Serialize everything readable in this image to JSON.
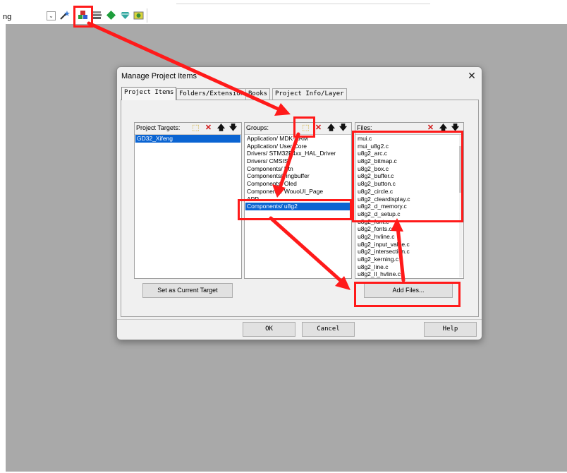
{
  "toolbar": {
    "partial_text": "ng",
    "dropdown_glyph": "⌄",
    "icons": [
      "magic-wand-icon",
      "manage-project-items-icon",
      "stack-icon",
      "green-diamond-icon",
      "gem-icon",
      "component-icon"
    ]
  },
  "dialog": {
    "title": "Manage Project Items",
    "close_glyph": "✕",
    "tabs": [
      {
        "label": "Project Items"
      },
      {
        "label": "Folders/Extensions"
      },
      {
        "label": "Books"
      },
      {
        "label": "Project Info/Layer"
      }
    ],
    "targets": {
      "header": "Project Targets:",
      "items": [
        "GD32_Xifeng"
      ],
      "selected": "GD32_Xifeng"
    },
    "groups": {
      "header": "Groups:",
      "items": [
        "Application/ MDK-ARM",
        "Application/ User/Core",
        "Drivers/ STM32F4xx_HAL_Driver",
        "Drivers/ CMSIS",
        "Components/ Btn",
        "Components/ ringbuffer",
        "Components/ Oled",
        "Components/ WouoUI_Page",
        "APP",
        "Components/ u8g2"
      ],
      "selected": "Components/ u8g2"
    },
    "files": {
      "header": "Files:",
      "items": [
        "mui.c",
        "mui_u8g2.c",
        "u8g2_arc.c",
        "u8g2_bitmap.c",
        "u8g2_box.c",
        "u8g2_buffer.c",
        "u8g2_button.c",
        "u8g2_circle.c",
        "u8g2_cleardisplay.c",
        "u8g2_d_memory.c",
        "u8g2_d_setup.c",
        "u8g2_font.c",
        "u8g2_fonts.c",
        "u8g2_hvline.c",
        "u8g2_input_value.c",
        "u8g2_intersection.c",
        "u8g2_kerning.c",
        "u8g2_line.c",
        "u8g2_ll_hvline.c"
      ]
    },
    "pane_buttons": {
      "new": "⬚",
      "delete": "✕",
      "up": "🡅",
      "down": "🡇"
    },
    "buttons": {
      "set_target": "Set as Current Target",
      "add_files": "Add Files...",
      "ok": "OK",
      "cancel": "Cancel",
      "help": "Help"
    }
  },
  "colors": {
    "background": "#a9a9a9",
    "dialog": "#f0f0f0",
    "selection": "#0a64d2",
    "annotation": "#ff1a1a"
  }
}
